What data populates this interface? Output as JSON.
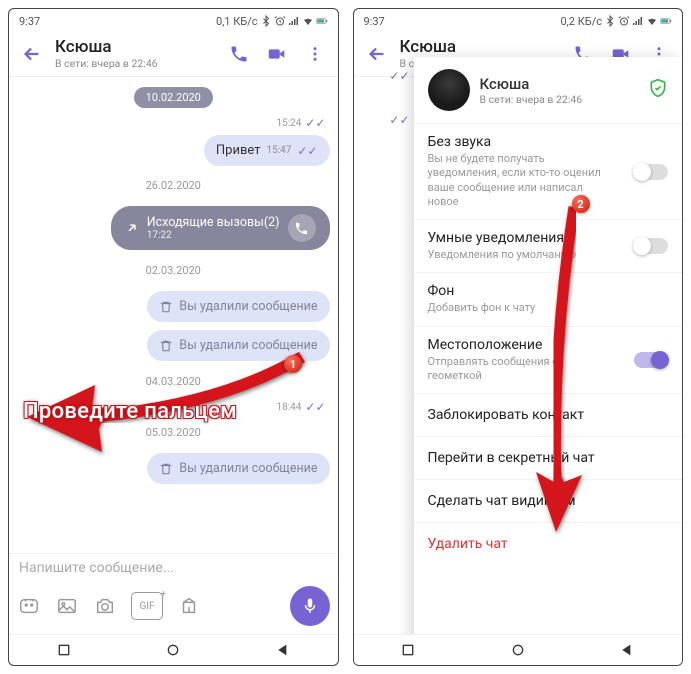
{
  "status": {
    "time": "9:37",
    "net": "0,1 КБ/с",
    "net2": "0,2 КБ/с"
  },
  "header": {
    "name": "Ксюша",
    "sub": "В сети: вчера в 22:46"
  },
  "chat": {
    "d1": "10.02.2020",
    "t1": "15:24",
    "msg1": "Привет",
    "t2": "15:47",
    "d2": "26.02.2020",
    "call": "Исходящие вызовы(2)",
    "calltime": "17:22",
    "d3": "02.03.2020",
    "del": "Вы удалили сообщение",
    "d4": "04.03.2020",
    "t3": "18:44",
    "d5": "05.03.2020"
  },
  "input": {
    "placeholder": "Напишите сообщение...",
    "gif": "GIF"
  },
  "swipe": "Проведите пальцем",
  "panel": {
    "mute_t": "Без звука",
    "mute_d": "Вы не будете получать уведомления, если кто-то оценил ваше сообщение или написал новое",
    "smart_t": "Умные уведомления",
    "smart_d": "Уведомления по умолчанию",
    "bg_t": "Фон",
    "bg_d": "Добавить фон к чату",
    "loc_t": "Местоположение",
    "loc_d": "Отправлять сообщения с геометкой",
    "block": "Заблокировать контакт",
    "secret": "Перейти в секретный чат",
    "visible": "Сделать чат видимым",
    "delete": "Удалить чат"
  },
  "markers": {
    "m1": "1",
    "m2": "2"
  }
}
